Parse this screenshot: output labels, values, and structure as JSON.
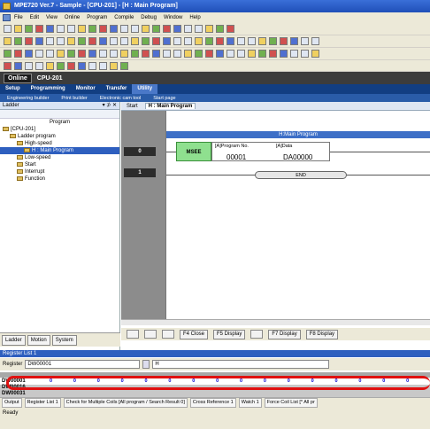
{
  "title": "MPE720 Ver.7 - Sample - [CPU-201] - [H : Main Program]",
  "menu": [
    "File",
    "Edit",
    "View",
    "Online",
    "Program",
    "Compile",
    "Debug",
    "Window",
    "Help"
  ],
  "status": {
    "online": "Online",
    "cpu": "CPU-201"
  },
  "main_tabs": [
    "Setup",
    "Programming",
    "Monitor",
    "Transfer",
    "Utility"
  ],
  "active_tab": "Utility",
  "sub_tabs": [
    "Engineering builder",
    "Print builder",
    "Electronic cam tool",
    "Start page"
  ],
  "left_panel": {
    "title": "Ladder",
    "pin": "▾ ⊅ ✕",
    "tree": [
      {
        "label": "Program",
        "indent": 0
      },
      {
        "label": "[CPU-201]",
        "indent": 0
      },
      {
        "label": "Ladder program",
        "indent": 1
      },
      {
        "label": "High-speed",
        "indent": 2
      },
      {
        "label": "H : Main Program",
        "indent": 3
      },
      {
        "label": "Low-speed",
        "indent": 2
      },
      {
        "label": "Start",
        "indent": 2
      },
      {
        "label": "Interrupt",
        "indent": 2
      },
      {
        "label": "Function",
        "indent": 2
      }
    ],
    "bottom_tabs": [
      "Ladder",
      "Motion",
      "System"
    ]
  },
  "editor": {
    "tabs": [
      "Start",
      "H : Main Program"
    ],
    "header": "H:Main Program",
    "rungs": [
      "0",
      "1"
    ],
    "block": {
      "name": "MSEE",
      "param1_label": "[A]Program No.",
      "param2_label": "[A]Data",
      "value1": "00001",
      "value2": "DA00000"
    },
    "end": "END"
  },
  "fkeys": [
    "F4 Close",
    "F5 Display",
    "F7 Display",
    "F8 Display"
  ],
  "register": {
    "title": "Register List 1",
    "label": "Register",
    "value": "DW00001",
    "second": "H",
    "rows": [
      {
        "name": "DW00001",
        "cells": [
          "0",
          "0",
          "0",
          "0",
          "0",
          "0",
          "0",
          "0",
          "0",
          "0",
          "0",
          "0",
          "0",
          "0",
          "0",
          "0"
        ]
      },
      {
        "name": "DW00016",
        "cells": []
      },
      {
        "name": "DW00031",
        "cells": []
      }
    ]
  },
  "bottom_tabs": [
    "Output",
    "Register List 1",
    "Check for Multiple Coils [All program / Search Result 0]",
    "Cross Reference 1",
    "Watch 1",
    "Force Coil List [* All pr"
  ],
  "statusbar": "Ready"
}
